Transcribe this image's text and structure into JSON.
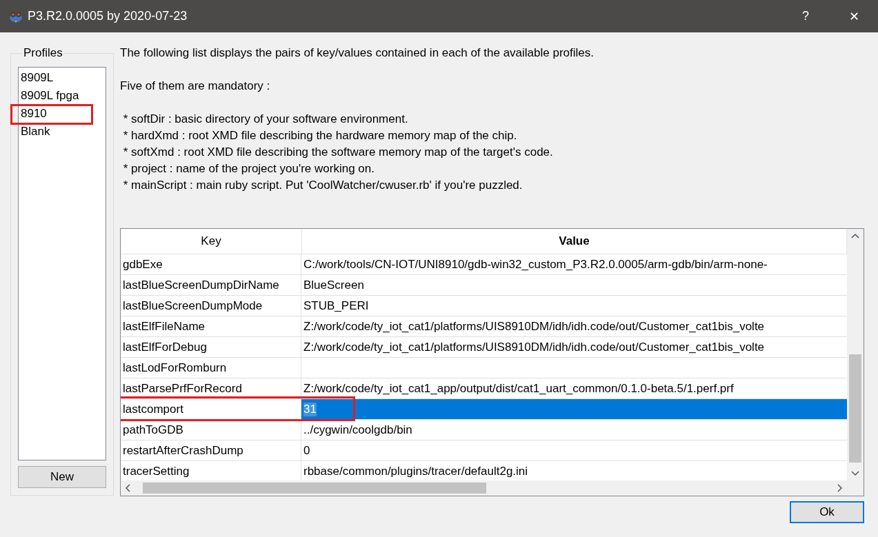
{
  "window": {
    "title": "P3.R2.0.0005 by 2020-07-23",
    "buttons": [
      "?",
      "✕"
    ]
  },
  "profiles": {
    "label": "Profiles",
    "items": [
      {
        "label": "8909L",
        "selected": false,
        "highlighted": false
      },
      {
        "label": "8909L fpga",
        "selected": false,
        "highlighted": false
      },
      {
        "label": "8910",
        "selected": false,
        "highlighted": true
      },
      {
        "label": "Blank",
        "selected": false,
        "highlighted": false
      }
    ],
    "new_button": "New"
  },
  "description": {
    "intro": "The following list displays the pairs of key/values contained in each of the available profiles.",
    "heading": "Five of them are mandatory :",
    "items": [
      " * softDir : basic directory of your software environment.",
      " * hardXmd : root XMD file describing the hardware memory map of the chip.",
      " * softXmd : root XMD file describing the software memory map of the target's code.",
      " * project : name of the project you're working on.",
      " * mainScript : main ruby script. Put 'CoolWatcher/cwuser.rb' if you're puzzled."
    ]
  },
  "table": {
    "columns": [
      "Key",
      "Value"
    ],
    "rows": [
      {
        "key": "gdbExe",
        "value": "C:/work/tools/CN-IOT/UNI8910/gdb-win32_custom_P3.R2.0.0005/arm-gdb/bin/arm-none-",
        "selected": false,
        "highlighted": false
      },
      {
        "key": "lastBlueScreenDumpDirName",
        "value": "BlueScreen",
        "selected": false,
        "highlighted": false
      },
      {
        "key": "lastBlueScreenDumpMode",
        "value": "STUB_PERI",
        "selected": false,
        "highlighted": false
      },
      {
        "key": "lastElfFileName",
        "value": "Z:/work/code/ty_iot_cat1/platforms/UIS8910DM/idh/idh.code/out/Customer_cat1bis_volte",
        "selected": false,
        "highlighted": false
      },
      {
        "key": "lastElfForDebug",
        "value": "Z:/work/code/ty_iot_cat1/platforms/UIS8910DM/idh/idh.code/out/Customer_cat1bis_volte",
        "selected": false,
        "highlighted": false
      },
      {
        "key": "lastLodForRomburn",
        "selected": false,
        "highlighted": false
      },
      {
        "key": "lastParsePrfForRecord",
        "value": "Z:/work/code/ty_iot_cat1_app/output/dist/cat1_uart_common/0.1.0-beta.5/1.perf.prf",
        "selected": false,
        "highlighted": false
      },
      {
        "key": "lastcomport",
        "value": "31",
        "selected": true,
        "highlighted": true
      },
      {
        "key": "pathToGDB",
        "value": "../cygwin/coolgdb/bin",
        "selected": false,
        "highlighted": false
      },
      {
        "key": "restartAfterCrashDump",
        "value": "0",
        "selected": false,
        "highlighted": false
      },
      {
        "key": "tracerSetting",
        "value": "rbbase/common/plugins/tracer/default2g.ini",
        "selected": false,
        "highlighted": false
      }
    ]
  },
  "ok_button": "Ok"
}
